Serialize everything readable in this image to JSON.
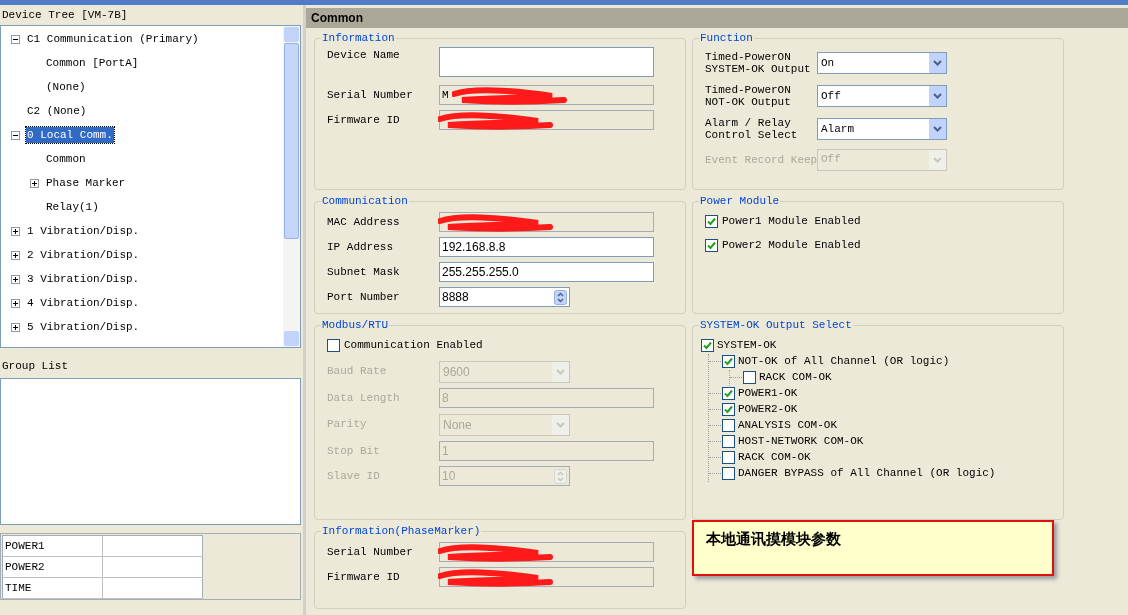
{
  "device_tree": {
    "title": "Device Tree [VM-7B]",
    "items": [
      {
        "label": "C1 Communication (Primary)",
        "selected": false,
        "expanded": true,
        "children": [
          {
            "label": "Common [PortA]",
            "selected": false
          },
          {
            "label": "(None)",
            "selected": false
          }
        ]
      },
      {
        "label": "C2 (None)",
        "selected": false
      },
      {
        "label": "0 Local Comm.",
        "selected": true,
        "expanded": true,
        "children": [
          {
            "label": "Common",
            "selected": false
          },
          {
            "label": "Phase Marker",
            "selected": false,
            "expanded": false
          },
          {
            "label": "Relay(1)",
            "selected": false
          }
        ]
      },
      {
        "label": "1 Vibration/Disp.",
        "selected": false,
        "expanded": false
      },
      {
        "label": "2 Vibration/Disp.",
        "selected": false,
        "expanded": false
      },
      {
        "label": "3 Vibration/Disp.",
        "selected": false,
        "expanded": false
      },
      {
        "label": "4 Vibration/Disp.",
        "selected": false,
        "expanded": false
      },
      {
        "label": "5 Vibration/Disp.",
        "selected": false,
        "expanded": false
      }
    ]
  },
  "group_list": {
    "title": "Group List"
  },
  "status_table": {
    "rows": [
      {
        "label": "POWER1"
      },
      {
        "label": "POWER2"
      },
      {
        "label": "TIME"
      }
    ]
  },
  "panel": {
    "title": "Common"
  },
  "left_groups": [
    {
      "title": "Information",
      "fields": [
        {
          "kind": "textarea",
          "label": "Device Name"
        },
        {
          "kind": "readonly",
          "label": "Serial Number",
          "value": "M",
          "redacted": true
        },
        {
          "kind": "readonly",
          "label": "Firmware ID",
          "redacted": true
        }
      ]
    },
    {
      "title": "Communication",
      "fields": [
        {
          "kind": "readonly",
          "label": "MAC Address",
          "redacted": true
        },
        {
          "kind": "text",
          "label": "IP Address",
          "value": "192.168.8.8"
        },
        {
          "kind": "text",
          "label": "Subnet Mask",
          "value": "255.255.255.0"
        },
        {
          "kind": "spin",
          "label": "Port Number",
          "value": "8888"
        }
      ]
    },
    {
      "title": "Modbus/RTU",
      "fields": [
        {
          "kind": "checkbox",
          "label": "Communication Enabled",
          "checked": false
        },
        {
          "kind": "select",
          "label": "Baud Rate",
          "value": "9600",
          "disabled": true
        },
        {
          "kind": "text",
          "label": "Data Length",
          "value": "8",
          "disabled": true
        },
        {
          "kind": "select",
          "label": "Parity",
          "value": "None",
          "disabled": true
        },
        {
          "kind": "text",
          "label": "Stop Bit",
          "value": "1",
          "disabled": true
        },
        {
          "kind": "spin",
          "label": "Slave ID",
          "value": "10",
          "disabled": true
        }
      ]
    },
    {
      "title": "Information(PhaseMarker)",
      "fields": [
        {
          "kind": "readonly",
          "label": "Serial Number",
          "redacted": true
        },
        {
          "kind": "readonly",
          "label": "Firmware ID",
          "redacted": true
        }
      ]
    }
  ],
  "right_groups": [
    {
      "title": "Function",
      "fields": [
        {
          "kind": "select",
          "label_lines": [
            "Timed-PowerON",
            "SYSTEM-OK Output"
          ],
          "value": "On",
          "disabled": false
        },
        {
          "kind": "select",
          "label_lines": [
            "Timed-PowerON",
            "NOT-OK Output"
          ],
          "value": "Off",
          "disabled": false
        },
        {
          "kind": "select",
          "label_lines": [
            "Alarm / Relay",
            "Control Select"
          ],
          "value": "Alarm",
          "disabled": false
        },
        {
          "kind": "select",
          "label_lines": [
            "Event Record Keep"
          ],
          "value": "Off",
          "disabled": true
        }
      ]
    },
    {
      "title": "Power Module",
      "fields": [
        {
          "kind": "checkbox",
          "label": "Power1 Module Enabled",
          "checked": true
        },
        {
          "kind": "checkbox",
          "label": "Power2 Module Enabled",
          "checked": true
        }
      ]
    },
    {
      "title": "SYSTEM-OK Output Select",
      "fields": [
        {
          "kind": "checktree",
          "label": "SYSTEM-OK",
          "checked": true,
          "children": [
            {
              "label": "NOT-OK of All Channel (OR logic)",
              "checked": true,
              "children": [
                {
                  "label": "RACK COM-OK",
                  "checked": false
                }
              ]
            },
            {
              "label": "POWER1-OK",
              "checked": true
            },
            {
              "label": "POWER2-OK",
              "checked": true
            },
            {
              "label": "ANALYSIS COM-OK",
              "checked": false
            },
            {
              "label": "HOST-NETWORK COM-OK",
              "checked": false
            },
            {
              "label": "RACK COM-OK",
              "checked": false
            },
            {
              "label": "DANGER BYPASS of All Channel (OR logic)",
              "checked": false
            }
          ]
        }
      ]
    }
  ],
  "note": {
    "text": "本地通讯摸模块参数"
  }
}
